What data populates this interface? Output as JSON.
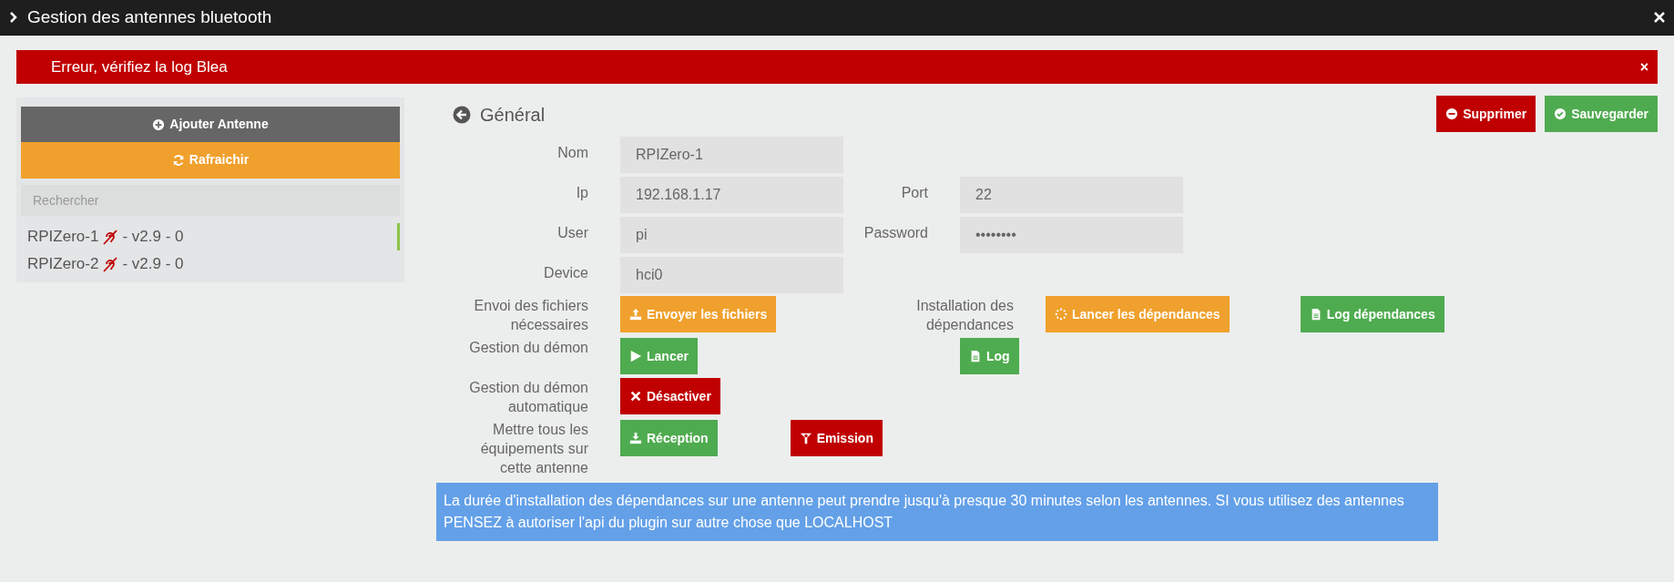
{
  "window": {
    "title": "Gestion des antennes bluetooth"
  },
  "alert": {
    "text": "Erreur, vérifiez la log Blea",
    "close": "×"
  },
  "sidebar": {
    "add_button": "Ajouter Antenne",
    "refresh_button": "Rafraichir",
    "search": {
      "placeholder": "Rechercher"
    },
    "items": [
      {
        "name": "RPIZero-1",
        "suffix": "- v2.9 - 0",
        "selected": true
      },
      {
        "name": "RPIZero-2",
        "suffix": "- v2.9 - 0",
        "selected": false
      }
    ]
  },
  "header": {
    "title": "Général",
    "buttons": [
      {
        "label": "Supprimer",
        "kind": "danger"
      },
      {
        "label": "Sauvegarder",
        "kind": "success"
      }
    ]
  },
  "fields": [
    {
      "label": "Nom",
      "value": "RPIZero-1"
    },
    {
      "label": "Ip",
      "value": "192.168.1.17",
      "extra": {
        "label": "Port",
        "value": "22"
      }
    },
    {
      "label": "User",
      "value": "pi",
      "extra": {
        "label": "Password",
        "value": "••••••••"
      }
    },
    {
      "label": "Device",
      "value": "hci0"
    }
  ],
  "actions": [
    {
      "label": "Envoi des fichiers nécessaires",
      "buttons": [
        {
          "label": "Envoyer les fichiers",
          "kind": "warning"
        }
      ],
      "right": {
        "label": "Installation des dépendances",
        "buttons": [
          {
            "label": "Lancer les dépendances",
            "kind": "warning"
          },
          {
            "label": "Log dépendances",
            "kind": "success"
          }
        ]
      }
    },
    {
      "label": "Gestion du démon",
      "buttons": [
        {
          "label": "Lancer",
          "kind": "success"
        }
      ],
      "right": {
        "buttons": [
          {
            "label": "Log",
            "kind": "success"
          }
        ]
      }
    },
    {
      "label": "Gestion du démon automatique",
      "buttons": [
        {
          "label": "Désactiver",
          "kind": "danger"
        }
      ]
    },
    {
      "label": "Mettre tous les équipements sur cette antenne",
      "buttons": [
        {
          "label": "Réception",
          "kind": "success"
        },
        {
          "label": "Emission",
          "kind": "danger"
        }
      ]
    }
  ],
  "info": "La durée d'installation des dépendances sur une antenne peut prendre jusqu'à presque 30 minutes selon les antennes. SI vous utilisez des antennes PENSEZ à autoriser l'api du plugin sur autre chose que LOCALHOST"
}
